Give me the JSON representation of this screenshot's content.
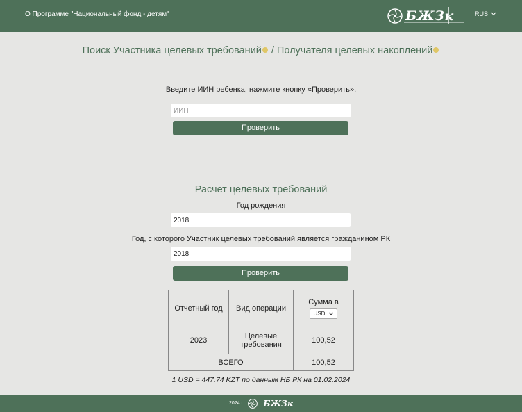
{
  "header": {
    "about_link": "О Программе \"Национальный фонд - детям\"",
    "logo_text": "БЖЗк",
    "language": "RUS"
  },
  "search": {
    "title_part1": "Поиск Участника целевых требований",
    "title_sep": "/",
    "title_part2": "Получателя целевых накоплений",
    "instruction": "Введите ИИН ребенка, нажмите кнопку «Проверить».",
    "iin_placeholder": "ИИН",
    "check_button": "Проверить"
  },
  "calc": {
    "title": "Расчет целевых требований",
    "birth_year_label": "Год рождения",
    "birth_year_value": "2018",
    "citizen_year_label": "Год, с которого Участник целевых требований является гражданином РК",
    "citizen_year_value": "2018",
    "check_button": "Проверить"
  },
  "table": {
    "headers": [
      "Отчетный год",
      "Вид операции",
      "Сумма в"
    ],
    "currency": "USD",
    "rows": [
      {
        "year": "2023",
        "operation": "Целевые требования",
        "amount": "100,52"
      }
    ],
    "total_label": "ВСЕГО",
    "total_amount": "100,52"
  },
  "rate_note": "1 USD = 447.74 KZT по данным НБ РК на 01.02.2024",
  "footer": {
    "year": "2024 г.",
    "logo_text": "БЖЗк"
  },
  "colors": {
    "brand_green": "#4e7159",
    "accent_yellow": "#e0c767",
    "background": "#e6e6e4"
  }
}
